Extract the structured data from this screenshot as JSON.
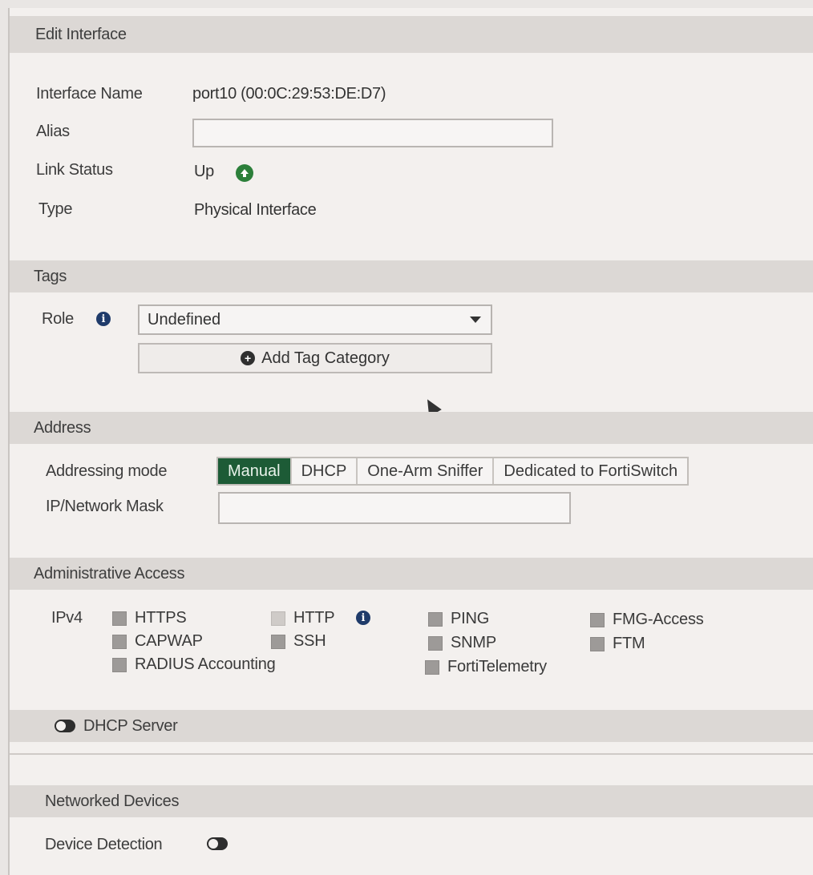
{
  "header": {
    "title": "Edit Interface"
  },
  "interface": {
    "name_label": "Interface Name",
    "name_value": "port10 (00:0C:29:53:DE:D7)",
    "alias_label": "Alias",
    "alias_value": "",
    "link_status_label": "Link Status",
    "link_status_value": "Up",
    "type_label": "Type",
    "type_value": "Physical Interface"
  },
  "tags": {
    "title": "Tags",
    "role_label": "Role",
    "role_value": "Undefined",
    "add_tag_label": "Add Tag Category"
  },
  "address": {
    "title": "Address",
    "mode_label": "Addressing mode",
    "modes": [
      "Manual",
      "DHCP",
      "One-Arm Sniffer",
      "Dedicated to FortiSwitch"
    ],
    "active_mode": "Manual",
    "ip_label": "IP/Network Mask",
    "ip_value": ""
  },
  "admin_access": {
    "title": "Administrative Access",
    "ipv4_label": "IPv4",
    "options": {
      "https": "HTTPS",
      "http": "HTTP",
      "ping": "PING",
      "fmg": "FMG-Access",
      "capwap": "CAPWAP",
      "ssh": "SSH",
      "snmp": "SNMP",
      "ftm": "FTM",
      "radius": "RADIUS Accounting",
      "fortitelemetry": "FortiTelemetry"
    }
  },
  "dhcp": {
    "label": "DHCP Server"
  },
  "networked": {
    "title": "Networked Devices",
    "device_detection_label": "Device Detection"
  },
  "colors": {
    "active_mode_bg": "#1d5b36",
    "link_up": "#2c7f3a",
    "info_icon": "#1f3b6a"
  }
}
